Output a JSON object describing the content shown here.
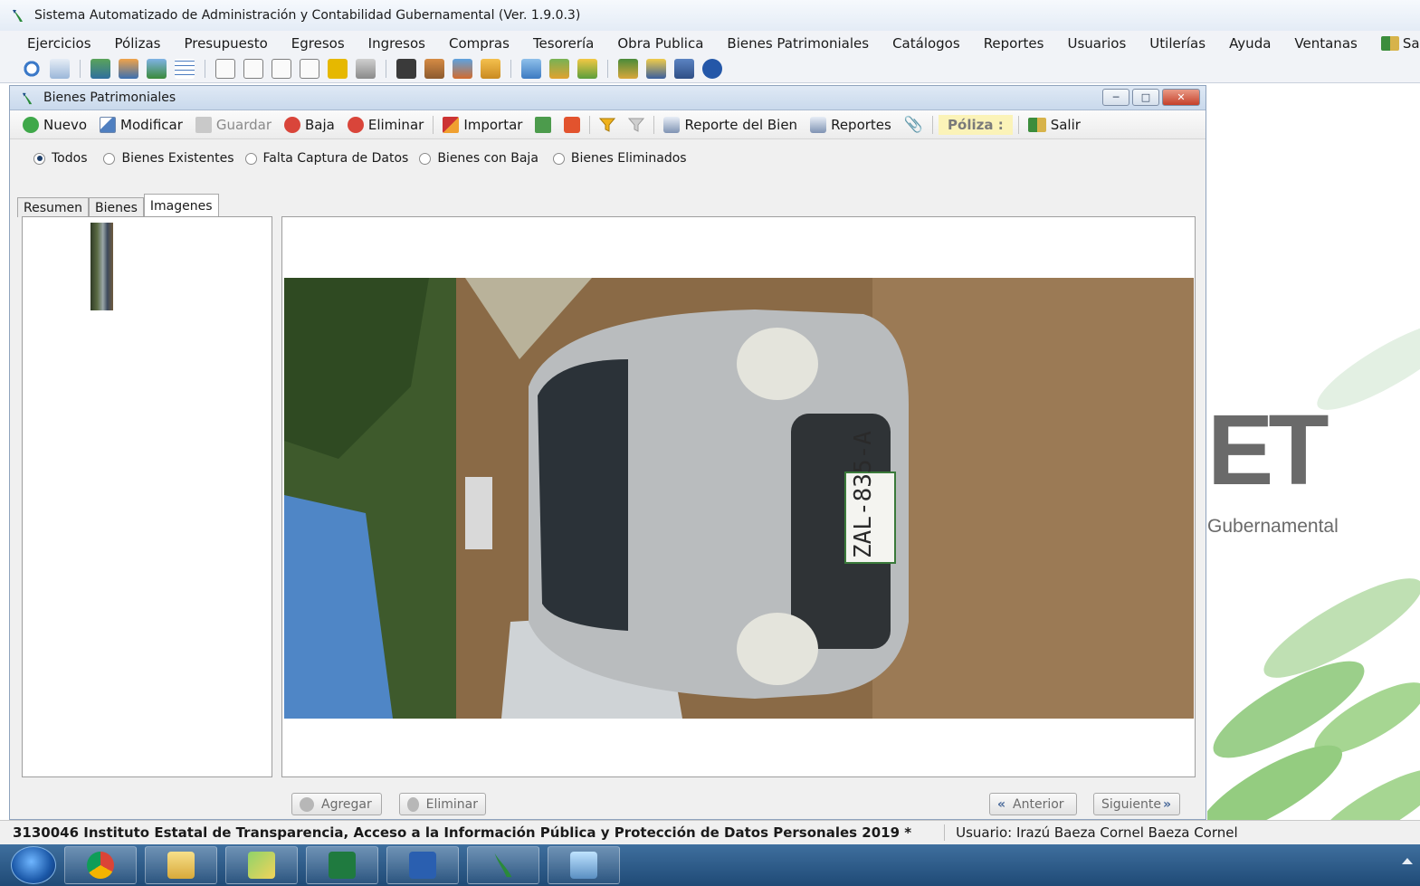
{
  "app": {
    "title": "Sistema Automatizado de Administración y Contabilidad Gubernamental  (Ver. 1.9.0.3)"
  },
  "menu": [
    "Ejercicios",
    "Pólizas",
    "Presupuesto",
    "Egresos",
    "Ingresos",
    "Compras",
    "Tesorería",
    "Obra Publica",
    "Bienes Patrimoniales",
    "Catálogos",
    "Reportes",
    "Usuarios",
    "Utilerías",
    "Ayuda",
    "Ventanas",
    "Sal"
  ],
  "inner_window": {
    "title": "Bienes Patrimoniales",
    "toolbar": {
      "nuevo": "Nuevo",
      "modificar": "Modificar",
      "guardar": "Guardar",
      "baja": "Baja",
      "eliminar": "Eliminar",
      "importar": "Importar",
      "reporte_bien": "Reporte del Bien",
      "reportes": "Reportes",
      "poliza": "Póliza :",
      "salir": "Salir"
    },
    "filters": {
      "todos": "Todos",
      "existentes": "Bienes Existentes",
      "falta_captura": "Falta Captura de Datos",
      "con_baja": "Bienes con Baja",
      "eliminados": "Bienes Eliminados",
      "selected": "Todos"
    },
    "tabs": {
      "resumen": "Resumen",
      "bienes": "Bienes",
      "imagenes": "Imagenes",
      "active": "Imagenes"
    },
    "photo": {
      "plate": "ZAL-835-A"
    },
    "buttons": {
      "agregar": "Agregar",
      "eliminar": "Eliminar",
      "anterior": "Anterior",
      "siguiente": "Siguiente"
    }
  },
  "background": {
    "letters": "ET",
    "subtitle": "Gubernamental"
  },
  "status": {
    "entity": "3130046 Instituto Estatal de Transparencia, Acceso a la Información Pública y Protección de Datos Personales  2019  *",
    "user": "Usuario: Irazú Baeza Cornel Baeza Cornel"
  },
  "taskbar_apps": [
    "windows-start",
    "chrome",
    "file-explorer",
    "folder",
    "excel",
    "word",
    "saacg",
    "photos"
  ]
}
